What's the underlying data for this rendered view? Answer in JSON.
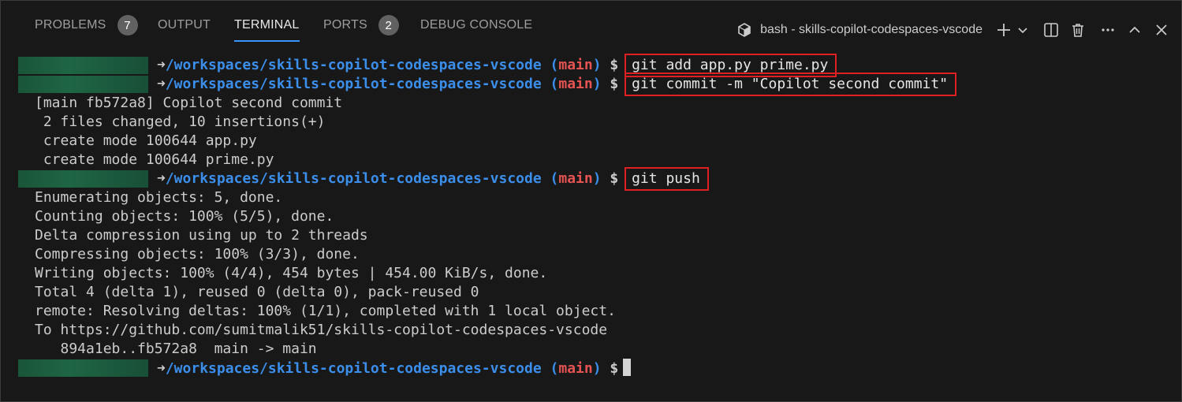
{
  "tabs": [
    {
      "label": "PROBLEMS",
      "badge": "7"
    },
    {
      "label": "OUTPUT"
    },
    {
      "label": "TERMINAL",
      "active": true
    },
    {
      "label": "PORTS",
      "badge": "2"
    },
    {
      "label": "DEBUG CONSOLE"
    }
  ],
  "terminal_title": "bash - skills-copilot-codespaces-vscode",
  "icons": [
    "terminal-icon",
    "plus-icon",
    "chevron-down-icon",
    "split-icon",
    "trash-icon",
    "more-icon",
    "chevron-up-icon",
    "close-icon"
  ],
  "prompt": {
    "arrow": "➜",
    "path": "/workspaces/skills-copilot-codespaces-vscode",
    "branch_open": "(",
    "branch": "main",
    "branch_close": ")",
    "dollar": "$"
  },
  "commands": [
    "git add app.py prime.py",
    "git commit -m \"Copilot second commit\"",
    "git push"
  ],
  "commit_output": [
    "[main fb572a8] Copilot second commit",
    " 2 files changed, 10 insertions(+)",
    " create mode 100644 app.py",
    " create mode 100644 prime.py"
  ],
  "push_output": [
    "Enumerating objects: 5, done.",
    "Counting objects: 100% (5/5), done.",
    "Delta compression using up to 2 threads",
    "Compressing objects: 100% (3/3), done.",
    "Writing objects: 100% (4/4), 454 bytes | 454.00 KiB/s, done.",
    "Total 4 (delta 1), reused 0 (delta 0), pack-reused 0",
    "remote: Resolving deltas: 100% (1/1), completed with 1 local object.",
    "To https://github.com/sumitmalik51/skills-copilot-codespaces-vscode",
    "   894a1eb..fb572a8  main -> main"
  ],
  "colors": {
    "background": "#181818",
    "path": "#3b8eea",
    "branch": "#e55353",
    "highlight_box": "#e02020",
    "active_tab_underline": "#3794ff"
  }
}
